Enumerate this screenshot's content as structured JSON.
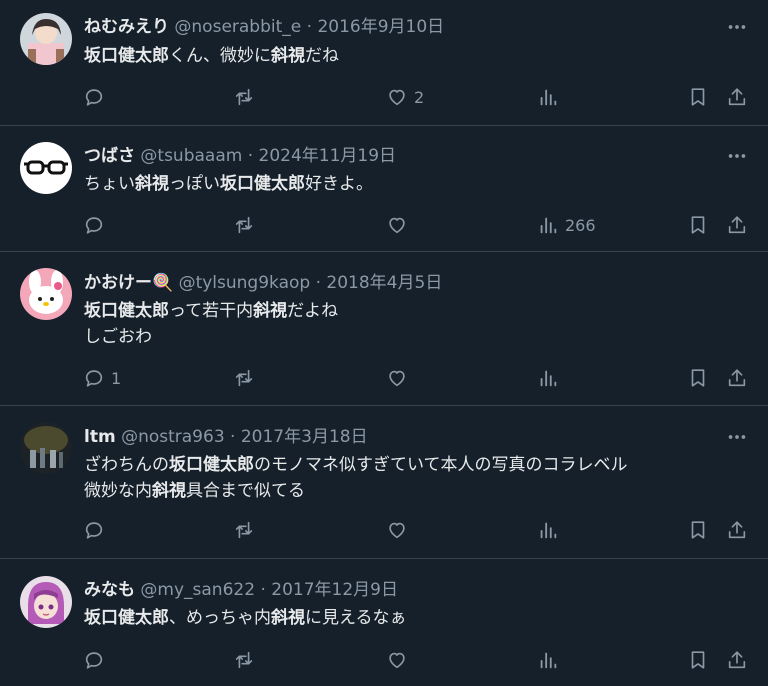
{
  "tweets": [
    {
      "name": "ねむみえり",
      "handle": "@noserabbit_e",
      "sep": "·",
      "date": "2016年9月10日",
      "lines": [
        [
          {
            "t": "坂口健太郎",
            "b": true
          },
          {
            "t": "くん、微妙に",
            "b": false
          },
          {
            "t": "斜視",
            "b": true
          },
          {
            "t": "だね",
            "b": false
          }
        ]
      ],
      "reply_count": "",
      "like_count": "2",
      "view_count": ""
    },
    {
      "name": "つばさ",
      "handle": "@tsubaaam",
      "sep": "·",
      "date": "2024年11月19日",
      "lines": [
        [
          {
            "t": "ちょい",
            "b": false
          },
          {
            "t": "斜視",
            "b": true
          },
          {
            "t": "っぽい",
            "b": false
          },
          {
            "t": "坂口健太郎",
            "b": true
          },
          {
            "t": "好きよ。",
            "b": false
          }
        ]
      ],
      "reply_count": "",
      "like_count": "",
      "view_count": "266"
    },
    {
      "name": "かおけー🍭",
      "handle": "@tylsung9kaop",
      "sep": "·",
      "date": "2018年4月5日",
      "lines": [
        [
          {
            "t": "坂口健太郎",
            "b": true
          },
          {
            "t": "って若干内",
            "b": false
          },
          {
            "t": "斜視",
            "b": true
          },
          {
            "t": "だよね",
            "b": false
          }
        ],
        [
          {
            "t": "しごおわ",
            "b": false
          }
        ]
      ],
      "reply_count": "1",
      "like_count": "",
      "view_count": ""
    },
    {
      "name": "ltm",
      "handle": "@nostra963",
      "sep": "·",
      "date": "2017年3月18日",
      "lines": [
        [
          {
            "t": "ざわちんの",
            "b": false
          },
          {
            "t": "坂口健太郎",
            "b": true
          },
          {
            "t": "のモノマネ似すぎていて本人の写真のコラレベル",
            "b": false
          }
        ],
        [
          {
            "t": "微妙な内",
            "b": false
          },
          {
            "t": "斜視",
            "b": true
          },
          {
            "t": "具合まで似てる",
            "b": false
          }
        ]
      ],
      "reply_count": "",
      "like_count": "",
      "view_count": ""
    },
    {
      "name": "みなも",
      "handle": "@my_san622",
      "sep": "·",
      "date": "2017年12月9日",
      "lines": [
        [
          {
            "t": "坂口健太郎",
            "b": true
          },
          {
            "t": "、めっちゃ内",
            "b": false
          },
          {
            "t": "斜視",
            "b": true
          },
          {
            "t": "に見えるなぁ",
            "b": false
          }
        ]
      ],
      "reply_count": "",
      "like_count": "",
      "view_count": ""
    }
  ],
  "icons": {
    "reply": "reply-icon",
    "retweet": "retweet-icon",
    "like": "heart-icon",
    "views": "views-icon",
    "bookmark": "bookmark-icon",
    "share": "share-icon",
    "more": "more-icon"
  },
  "colors": {
    "background": "#15202b",
    "text": "#e7e9ea",
    "muted": "#8b98a5",
    "divider": "#38444d"
  }
}
